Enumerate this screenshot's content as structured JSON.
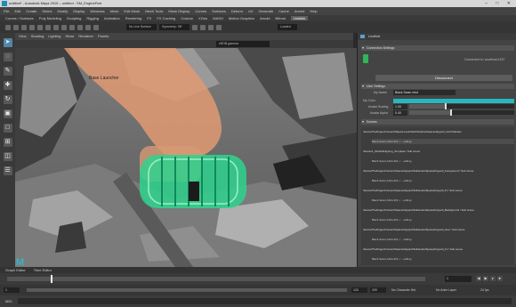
{
  "window": {
    "title": "untitled* - Autodesk Maya 2015 – untitled : SM_EnginePart",
    "controls": "– □ ✕"
  },
  "menubar": {
    "items": [
      "File",
      "Edit",
      "Create",
      "Select",
      "Modify",
      "Display",
      "Windows",
      "Mesh",
      "Edit Mesh",
      "Mesh Tools",
      "Mesh Display",
      "Curves",
      "Surfaces",
      "Deform",
      "UV",
      "Generate",
      "Cache",
      "Arnold",
      "Help"
    ]
  },
  "shelf": {
    "tabs": [
      "Curves / Surfaces",
      "Poly Modeling",
      "Sculpting",
      "Rigging",
      "Animation",
      "Rendering",
      "FX",
      "FX Caching",
      "Custom",
      "XGen",
      "MASH",
      "Motion Graphics",
      "Arnold",
      "Bifrost",
      "Livelink"
    ],
    "active_tab": "Livelink",
    "fields": [
      "No Live Surface",
      "Symmetry: Off",
      "Loaded"
    ]
  },
  "viewport": {
    "menu": [
      "View",
      "Shading",
      "Lighting",
      "Show",
      "Renderer",
      "Panels"
    ],
    "camera_field": "sRGB gamma",
    "label": "Base Launcher"
  },
  "panel": {
    "title": "Livelink",
    "connection": {
      "header": "Connection Settings",
      "status": "Connected to: localhost:1337",
      "disconnect_label": "Disconnect"
    },
    "user": {
      "header": "User Settings",
      "my_name_label": "My Name",
      "my_name_value": "Black Swan mkd",
      "my_color_label": "My Color",
      "my_color_value": "#27b7bf",
      "avatar_scaling_label": "Avatar Scaling",
      "avatar_scaling_value": "1.00",
      "avatar_scaling_level": 0.35,
      "avatar_alpha_label": "Avatar Alpha",
      "avatar_alpha_value": "0.40",
      "avatar_alpha_level": 0.4
    },
    "scenes": {
      "header": "Scenes",
      "rows": [
        {
          "text": "/Game/TheDrigen/Content/Maps/Levels/NorthStudios/Spaceshipyard_NorthStudios",
          "level": 0,
          "selected": false
        },
        {
          "text": "Black Swan (Ultra 3D) ✓ - editing",
          "level": 1,
          "selected": true
        },
        {
          "text": "/Game/1_ModelSHipping_Template / Sub scene",
          "level": 0,
          "selected": false
        },
        {
          "text": "Black Swan (Ultra 3D) ✓ - editing",
          "level": 1,
          "selected": false
        },
        {
          "text": "/Game/TheDrigen/Content/Spaceshipyard/Sublevels/Spaceshipyard_Foreground / Sub scene",
          "level": 0,
          "selected": false
        },
        {
          "text": "Black Swan (Ultra 3D) ✓ - editing",
          "level": 1,
          "selected": false
        },
        {
          "text": "/Game/TheDrigen/Content/Spaceshipyard/Sublevels/Spaceshipyard_FI / Sub scene",
          "level": 0,
          "selected": false
        },
        {
          "text": "Black Swan (Ultra 3D) ✓ - editing",
          "level": 1,
          "selected": false
        },
        {
          "text": "/Game/TheDrigen/Content/Spaceshipyard/Sublevels/Spaceshipyard_Background / Sub scene",
          "level": 0,
          "selected": false
        },
        {
          "text": "Black Swan (Ultra 3D) ✓ - editing",
          "level": 1,
          "selected": false
        },
        {
          "text": "/Game/TheDrigen/Content/Spaceshipyard/Sublevels/Spaceshipyard_Geo / Sub scene",
          "level": 0,
          "selected": false
        },
        {
          "text": "Black Swan (Ultra 3D) ✓ - editing",
          "level": 1,
          "selected": false
        },
        {
          "text": "/Game/TheDrigen/Content/Spaceshipyard/Sublevels/Spaceshipyard_Fx / Sub scene",
          "level": 0,
          "selected": false
        },
        {
          "text": "Black Swan (Ultra 3D) ✓ - editing",
          "level": 1,
          "selected": false
        }
      ]
    }
  },
  "bottom": {
    "tabs": [
      "Graph Editor",
      "Time Editor"
    ],
    "range_start": "1",
    "range_inner_start": "1",
    "range_inner_end": "120",
    "range_end": "200",
    "character_set": "No Character Set",
    "anim_layer": "No Anim Layer",
    "fps": "24 fps",
    "current_frame": "1",
    "cmd_label": "MEL"
  }
}
